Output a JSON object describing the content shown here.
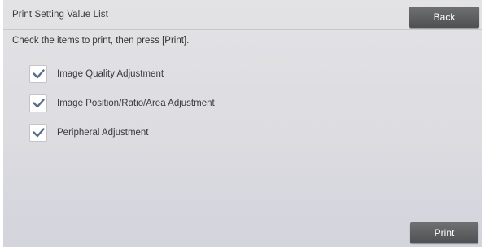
{
  "screen": {
    "title": "Print Setting Value List",
    "instructions": "Check the items to print, then press [Print]."
  },
  "buttons": {
    "back_label": "Back",
    "print_label": "Print"
  },
  "options": [
    {
      "label": "Image Quality Adjustment",
      "checked": true
    },
    {
      "label": "Image Position/Ratio/Area Adjustment",
      "checked": true
    },
    {
      "label": "Peripheral Adjustment",
      "checked": true
    }
  ],
  "colors": {
    "button_bg": "#5b5c5e",
    "checkmark": "#5a6d86",
    "background": "#dcdce1"
  },
  "icons": {
    "checkbox_checked": "checkmark-icon"
  }
}
